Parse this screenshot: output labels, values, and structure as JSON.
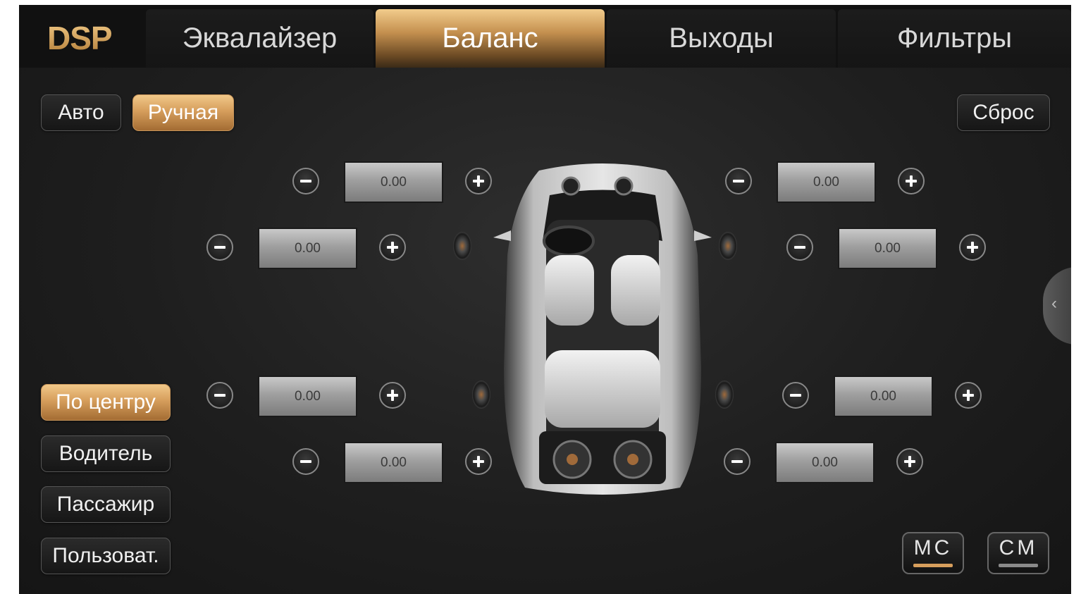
{
  "header": {
    "logo": "DSP",
    "tabs": [
      {
        "label": "Эквалайзер",
        "active": false
      },
      {
        "label": "Баланс",
        "active": true
      },
      {
        "label": "Выходы",
        "active": false
      },
      {
        "label": "Фильтры",
        "active": false
      }
    ]
  },
  "mode_buttons": {
    "auto": "Авто",
    "manual": "Ручная",
    "manual_active": true
  },
  "reset_label": "Сброс",
  "presets": [
    {
      "label": "По центру",
      "active": true
    },
    {
      "label": "Водитель",
      "active": false
    },
    {
      "label": "Пассажир",
      "active": false
    },
    {
      "label": "Пользоват.",
      "active": false
    }
  ],
  "channels": {
    "front_left_top": "0.00",
    "front_left": "0.00",
    "front_right_top": "0.00",
    "front_right": "0.00",
    "rear_left": "0.00",
    "rear_left_bottom": "0.00",
    "rear_right": "0.00",
    "rear_right_bottom": "0.00"
  },
  "bottom_modes": [
    {
      "label": "MC",
      "active": true
    },
    {
      "label": "CM",
      "active": false
    }
  ],
  "colors": {
    "accent": "#d69e5c",
    "background": "#1e1e1e",
    "value_box": "#a0a0a0"
  },
  "icons": {
    "minus": "minus-icon",
    "plus": "plus-icon",
    "collapse": "chevron-left-icon"
  }
}
